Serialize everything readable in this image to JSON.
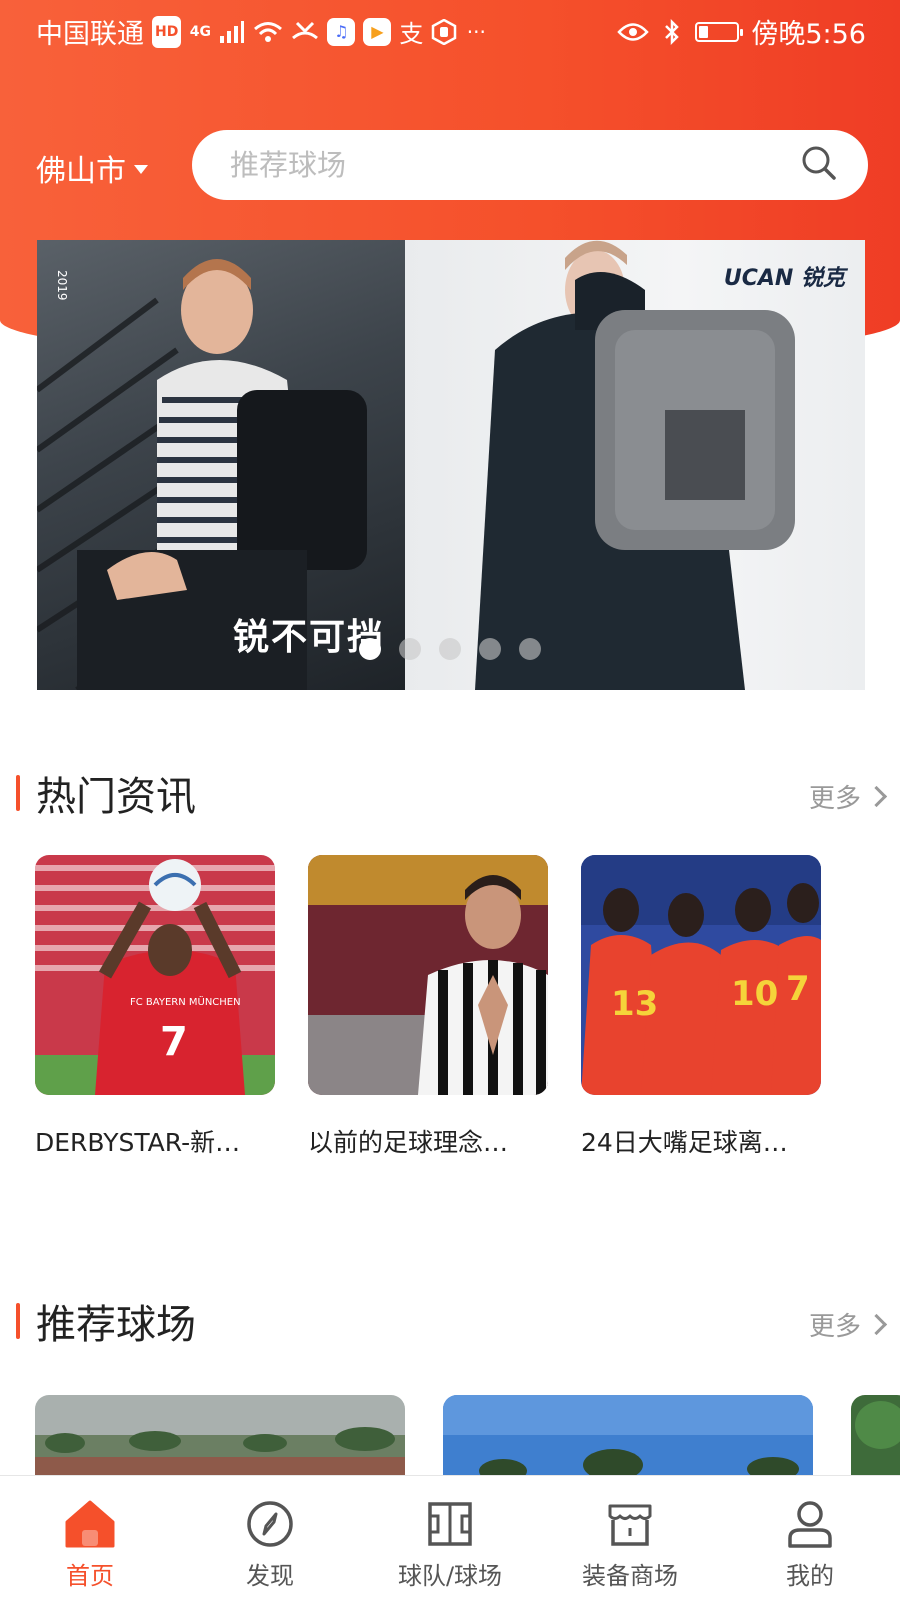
{
  "status_bar": {
    "carrier": "中国联通",
    "hd": "HD",
    "network": "4G",
    "time": "傍晚5:56",
    "battery_level": 0.25,
    "more": "···"
  },
  "header": {
    "city": "佛山市",
    "search_placeholder": "推荐球场"
  },
  "banner": {
    "brand": "UCAN 锐克",
    "slogan": "锐不可挡",
    "side_text": "2019",
    "active_dot": 0,
    "dot_count": 5
  },
  "hot_news": {
    "title": "热门资讯",
    "more_label": "更多",
    "items": [
      {
        "title": "DERBYSTAR-新…"
      },
      {
        "title": "以前的足球理念…"
      },
      {
        "title": "24日大嘴足球离…"
      }
    ]
  },
  "recommended_fields": {
    "title": "推荐球场",
    "more_label": "更多"
  },
  "tabbar": {
    "items": [
      {
        "label": "首页",
        "icon": "home-icon",
        "active": true
      },
      {
        "label": "发现",
        "icon": "compass-icon",
        "active": false
      },
      {
        "label": "球队/球场",
        "icon": "field-icon",
        "active": false
      },
      {
        "label": "装备商场",
        "icon": "store-icon",
        "active": false
      },
      {
        "label": "我的",
        "icon": "user-icon",
        "active": false
      }
    ]
  },
  "colors": {
    "accent": "#f5502b",
    "header_gradient_start": "#f8613a",
    "header_gradient_end": "#ef3d25"
  }
}
